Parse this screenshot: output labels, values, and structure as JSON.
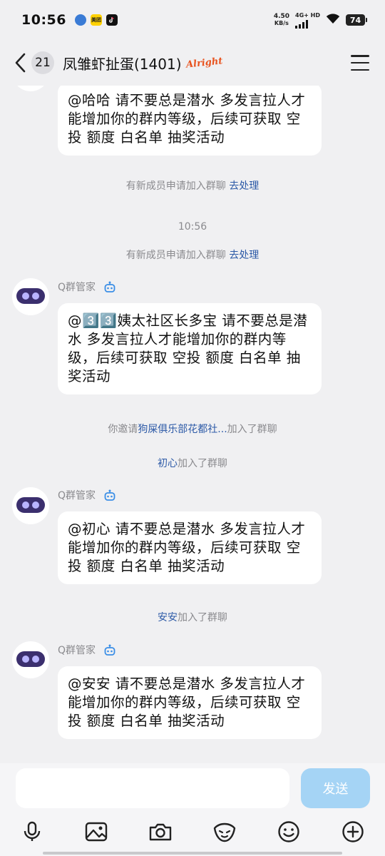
{
  "status_bar": {
    "time": "10:56",
    "app_icons": [
      {
        "name": "app-icon-blue",
        "label": "",
        "color": "#3a7bd5"
      },
      {
        "name": "meituan-icon",
        "label": "美团",
        "color": "#ffd100"
      },
      {
        "name": "douyin-icon",
        "label": "",
        "color": "#111111"
      }
    ],
    "speed_value": "4.50",
    "speed_unit": "KB/s",
    "network": "4G+ HD",
    "battery": "74"
  },
  "header": {
    "unread_count": "21",
    "title": "凤雏虾扯蛋(1401)",
    "tag": "Alright"
  },
  "messages": {
    "m1_text": "@哈哈 请不要总是潜水 多发言拉人才能增加你的群内等级，后续可获取 空投 额度 白名单 抽奖活动",
    "sys1_text": "有新成员申请加入群聊",
    "sys1_link": "去处理",
    "timestamp": "10:56",
    "sys2_text": "有新成员申请加入群聊",
    "sys2_link": "去处理",
    "m2_sender": "Q群管家",
    "m2_text": "@3️⃣3️⃣姨太社区长多宝 请不要总是潜水 多发言拉人才能增加你的群内等级，后续可获取 空投 额度 白名单 抽奖活动",
    "sys3_prefix": "你邀请",
    "sys3_name": "狗屎俱乐部花都社...",
    "sys3_suffix": "加入了群聊",
    "sys4_name": "初心",
    "sys4_suffix": "加入了群聊",
    "m3_sender": "Q群管家",
    "m3_text": "@初心 请不要总是潜水 多发言拉人才能增加你的群内等级，后续可获取 空投 额度 白名单 抽奖活动",
    "sys5_name": "安安",
    "sys5_suffix": "加入了群聊",
    "m4_sender": "Q群管家",
    "m4_text": "@安安 请不要总是潜水 多发言拉人才能增加你的群内等级，后续可获取 空投 额度 白名单 抽奖活动"
  },
  "input": {
    "placeholder": "",
    "send_label": "发送"
  },
  "toolbar": [
    "microphone-icon",
    "image-icon",
    "camera-icon",
    "sticker-icon",
    "emoji-icon",
    "plus-icon"
  ],
  "colors": {
    "background": "#f0f0f2",
    "link": "#2d5aa7",
    "send_button": "#a5d4f5",
    "bot_visor": "#3b2f6e"
  }
}
